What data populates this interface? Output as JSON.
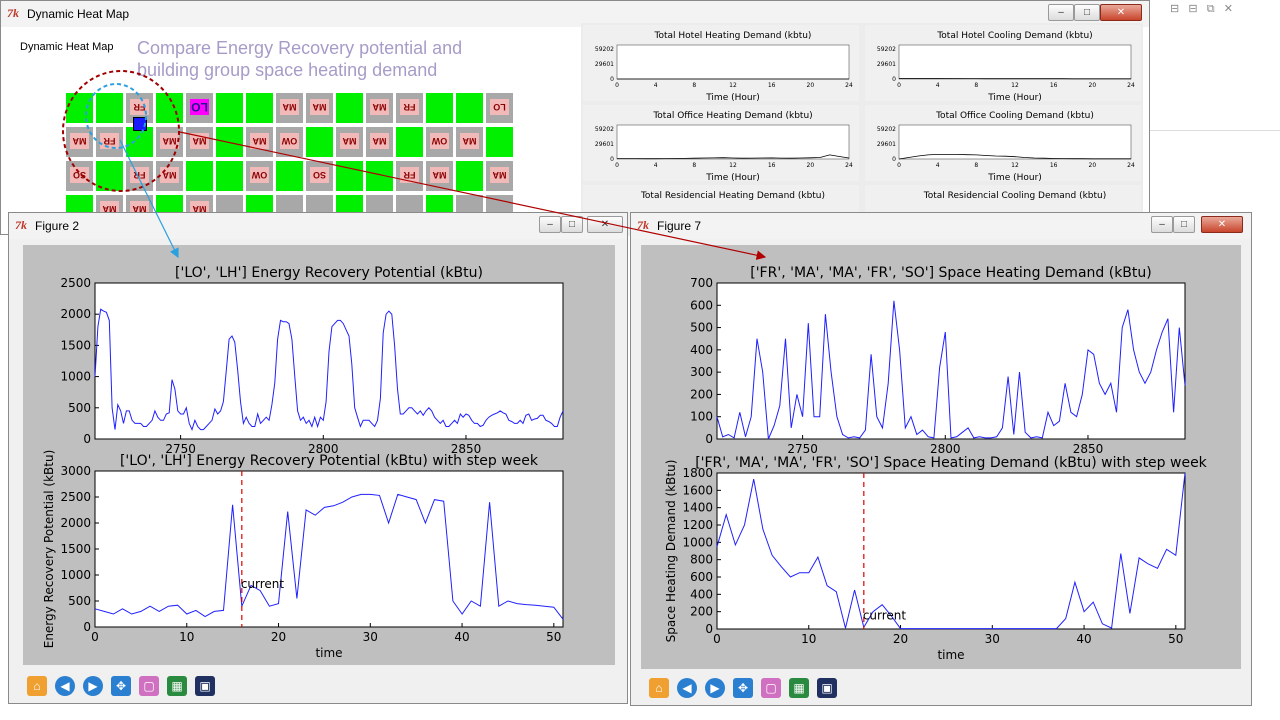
{
  "main_window": {
    "title": "Dynamic Heat Map",
    "panel_label": "Dynamic Heat Map"
  },
  "annotation": {
    "line1": "Compare Energy Recovery potential and",
    "line2": "building  group space heating demand",
    "color": "#a79cc8"
  },
  "map_labels": [
    "FR",
    "LO",
    "MA",
    "MA",
    "MA",
    "FR",
    "LO",
    "MA",
    "FR",
    "MA",
    "MA",
    "MA",
    "OW",
    "MA",
    "MA",
    "OW",
    "MA",
    "SO",
    "FR",
    "MA",
    "OW",
    "SO",
    "FR",
    "MA",
    "MA",
    "MA",
    "MA",
    "MA"
  ],
  "mini_charts": [
    {
      "title": "Total Hotel Heating Demand (kbtu)",
      "xlabel": "Time (Hour)",
      "yticks": [
        "59202",
        "29601",
        "0"
      ],
      "xticks": [
        "0",
        "4",
        "8",
        "12",
        "16",
        "20",
        "24"
      ],
      "values": [
        0,
        0,
        0,
        0,
        0,
        0,
        0,
        0,
        0,
        0,
        0,
        0,
        0,
        0,
        0,
        0,
        0,
        0,
        0,
        0,
        0,
        0,
        0,
        0,
        0
      ]
    },
    {
      "title": "Total Hotel Cooling Demand (kbtu)",
      "xlabel": "Time (Hour)",
      "yticks": [
        "59202",
        "29601",
        "0"
      ],
      "xticks": [
        "0",
        "4",
        "8",
        "12",
        "16",
        "20",
        "24"
      ],
      "values": [
        1200,
        1200,
        1200,
        1200,
        1100,
        1000,
        900,
        800,
        700,
        600,
        500,
        500,
        500,
        500,
        500,
        500,
        500,
        500,
        400,
        400,
        300,
        300,
        300,
        300,
        300
      ]
    },
    {
      "title": "Total Office Heating Demand (kbtu)",
      "xlabel": "Time (Hour)",
      "yticks": [
        "59202",
        "29601",
        "0"
      ],
      "xticks": [
        "0",
        "4",
        "8",
        "12",
        "16",
        "20",
        "24"
      ],
      "values": [
        800,
        800,
        700,
        500,
        500,
        700,
        900,
        1200,
        1500,
        2000,
        2200,
        2500,
        2000,
        1600,
        1800,
        2000,
        2200,
        1800,
        1600,
        2000,
        2300,
        3000,
        8000,
        5000,
        2000
      ]
    },
    {
      "title": "Total Office Cooling Demand (kbtu)",
      "xlabel": "Time (Hour)",
      "yticks": [
        "59202",
        "29601",
        "0"
      ],
      "xticks": [
        "0",
        "4",
        "8",
        "12",
        "16",
        "20",
        "24"
      ],
      "values": [
        0,
        3000,
        6000,
        8000,
        9000,
        9000,
        9000,
        8500,
        8000,
        7000,
        6000,
        5500,
        4500,
        3000,
        2000,
        1500,
        1000,
        800,
        600,
        500,
        400,
        300,
        300,
        300,
        300
      ]
    },
    {
      "title": "Total Residencial Heating Demand (kbtu)"
    },
    {
      "title": "Total Residencial Cooling Demand (kbtu)"
    }
  ],
  "figure2": {
    "title": "Figure 2",
    "chart_data": [
      {
        "type": "line",
        "title": "['LO', 'LH'] Energy Recovery Potential (kBtu)",
        "xlim": [
          2720,
          2884
        ],
        "ylim": [
          0,
          2500
        ],
        "xticks": [
          "2750",
          "2800",
          "2850"
        ],
        "yticks": [
          "0",
          "500",
          "1000",
          "1500",
          "2000",
          "2500"
        ],
        "color": "#2020ff",
        "x": [
          2720,
          2721,
          2722,
          2723,
          2724,
          2725,
          2726,
          2727,
          2728,
          2729,
          2730,
          2731,
          2732,
          2733,
          2734,
          2735,
          2736,
          2737,
          2738,
          2739,
          2740,
          2741,
          2742,
          2743,
          2744,
          2745,
          2746,
          2747,
          2748,
          2749,
          2750,
          2751,
          2752,
          2753,
          2754,
          2755,
          2756,
          2757,
          2758,
          2759,
          2760,
          2761,
          2762,
          2763,
          2764,
          2765,
          2766,
          2767,
          2768,
          2769,
          2770,
          2771,
          2772,
          2773,
          2774,
          2775,
          2776,
          2777,
          2778,
          2779,
          2780,
          2781,
          2782,
          2783,
          2784,
          2785,
          2786,
          2787,
          2788,
          2789,
          2790,
          2791,
          2792,
          2793,
          2794,
          2795,
          2796,
          2797,
          2798,
          2799,
          2800,
          2801,
          2802,
          2803,
          2804,
          2805,
          2806,
          2807,
          2808,
          2809,
          2810,
          2811,
          2812,
          2813,
          2814,
          2815,
          2816,
          2817,
          2818,
          2819,
          2820,
          2821,
          2822,
          2823,
          2824,
          2825,
          2826,
          2827,
          2828,
          2829,
          2830,
          2831,
          2832,
          2833,
          2834,
          2835,
          2836,
          2837,
          2838,
          2839,
          2840,
          2841,
          2842,
          2843,
          2844,
          2845,
          2846,
          2847,
          2848,
          2849,
          2850,
          2851,
          2852,
          2853,
          2854,
          2855,
          2856,
          2857,
          2858,
          2859,
          2860,
          2861,
          2862,
          2863,
          2864,
          2865,
          2866,
          2867,
          2868,
          2869,
          2870,
          2871,
          2872,
          2873,
          2874,
          2875,
          2876,
          2877,
          2878,
          2879,
          2880,
          2881,
          2882,
          2883,
          2884
        ],
        "y": [
          1000,
          1800,
          2080,
          2050,
          2030,
          1900,
          500,
          150,
          550,
          450,
          250,
          450,
          450,
          300,
          250,
          250,
          250,
          200,
          200,
          250,
          300,
          450,
          350,
          300,
          300,
          400,
          420,
          950,
          800,
          450,
          400,
          400,
          500,
          250,
          150,
          300,
          200,
          150,
          150,
          200,
          250,
          300,
          480,
          400,
          450,
          600,
          1100,
          1600,
          1650,
          1550,
          1100,
          600,
          250,
          350,
          250,
          200,
          200,
          400,
          250,
          300,
          350,
          300,
          550,
          900,
          1600,
          1900,
          1880,
          1880,
          1850,
          1600,
          1000,
          450,
          300,
          350,
          250,
          300,
          200,
          350,
          200,
          350,
          300,
          600,
          1400,
          1800,
          1850,
          1900,
          1900,
          1850,
          1750,
          1650,
          1200,
          500,
          350,
          200,
          300,
          300,
          300,
          250,
          200,
          300,
          650,
          1700,
          2000,
          2050,
          2000,
          1500,
          800,
          400,
          400,
          450,
          500,
          500,
          450,
          400,
          450,
          380,
          450,
          500,
          450,
          350,
          300,
          250,
          300,
          200,
          200,
          250,
          300,
          250,
          400,
          350,
          400,
          380,
          300,
          250,
          250,
          200,
          220,
          300,
          350,
          380,
          400,
          420,
          450,
          420,
          400,
          300,
          280,
          250,
          250,
          300,
          250,
          380,
          400,
          300,
          320,
          330,
          380,
          380,
          300,
          280,
          250,
          200,
          200,
          350,
          450,
          480,
          520,
          600,
          450
        ]
      },
      {
        "type": "line",
        "title": "['LO', 'LH'] Energy Recovery Potential (kBtu) with step week",
        "xlabel": "time",
        "ylabel": "Energy Recovery Potential (kBtu)",
        "xlim": [
          0,
          51
        ],
        "ylim": [
          0,
          3000
        ],
        "xticks": [
          "0",
          "10",
          "20",
          "30",
          "40",
          "50"
        ],
        "yticks": [
          "0",
          "500",
          "1000",
          "1500",
          "2000",
          "2500",
          "3000"
        ],
        "color": "#2020ff",
        "marker_x": 16,
        "marker_label": "current",
        "x": [
          0,
          1,
          2,
          3,
          4,
          5,
          6,
          7,
          8,
          9,
          10,
          11,
          12,
          13,
          14,
          15,
          16,
          17,
          18,
          19,
          20,
          21,
          22,
          23,
          24,
          25,
          26,
          27,
          28,
          29,
          30,
          31,
          32,
          33,
          34,
          35,
          36,
          37,
          38,
          39,
          40,
          41,
          42,
          43,
          44,
          45,
          46,
          47,
          48,
          49,
          50,
          51
        ],
        "y": [
          350,
          300,
          250,
          350,
          250,
          300,
          400,
          300,
          400,
          420,
          250,
          320,
          200,
          300,
          320,
          2350,
          400,
          800,
          700,
          400,
          450,
          2220,
          550,
          2250,
          2150,
          2300,
          2330,
          2400,
          2500,
          2550,
          2550,
          2530,
          2000,
          2550,
          2500,
          2450,
          2000,
          2450,
          2420,
          500,
          250,
          500,
          400,
          2400,
          400,
          500,
          450,
          430,
          420,
          400,
          380,
          150
        ]
      }
    ]
  },
  "figure7": {
    "title": "Figure 7",
    "chart_data": [
      {
        "type": "line",
        "title": "['FR', 'MA', 'MA', 'FR', 'SO'] Space Heating Demand (kBtu)",
        "xlim": [
          2720,
          2884
        ],
        "ylim": [
          0,
          700
        ],
        "xticks": [
          "2750",
          "2800",
          "2850"
        ],
        "yticks": [
          "0",
          "100",
          "200",
          "300",
          "400",
          "500",
          "600",
          "700"
        ],
        "color": "#2020ff",
        "x": [
          2720,
          2722,
          2724,
          2726,
          2728,
          2730,
          2732,
          2734,
          2736,
          2738,
          2740,
          2742,
          2744,
          2746,
          2748,
          2750,
          2752,
          2754,
          2756,
          2758,
          2760,
          2762,
          2764,
          2766,
          2768,
          2770,
          2772,
          2774,
          2776,
          2778,
          2780,
          2782,
          2784,
          2786,
          2788,
          2790,
          2792,
          2794,
          2796,
          2798,
          2800,
          2802,
          2804,
          2806,
          2808,
          2810,
          2812,
          2814,
          2816,
          2818,
          2820,
          2822,
          2824,
          2826,
          2828,
          2830,
          2832,
          2834,
          2836,
          2838,
          2840,
          2842,
          2844,
          2846,
          2848,
          2850,
          2852,
          2854,
          2856,
          2858,
          2860,
          2862,
          2864,
          2866,
          2868,
          2870,
          2872,
          2874,
          2876,
          2878,
          2880,
          2882,
          2884
        ],
        "y": [
          100,
          10,
          20,
          5,
          120,
          10,
          100,
          450,
          300,
          0,
          60,
          150,
          450,
          50,
          200,
          100,
          520,
          100,
          100,
          560,
          300,
          100,
          20,
          5,
          10,
          5,
          40,
          380,
          100,
          50,
          250,
          620,
          400,
          50,
          100,
          20,
          40,
          10,
          5,
          320,
          480,
          5,
          10,
          30,
          50,
          5,
          10,
          5,
          5,
          10,
          50,
          280,
          20,
          300,
          30,
          5,
          10,
          5,
          120,
          60,
          80,
          250,
          120,
          100,
          200,
          400,
          380,
          250,
          200,
          250,
          120,
          500,
          580,
          400,
          300,
          250,
          300,
          400,
          480,
          540,
          120,
          500,
          240
        ]
      },
      {
        "type": "line",
        "title": "['FR', 'MA', 'MA', 'FR', 'SO'] Space Heating Demand (kBtu) with step week",
        "xlabel": "time",
        "ylabel": "Space Heating Demand (kBtu)",
        "xlim": [
          0,
          51
        ],
        "ylim": [
          0,
          1800
        ],
        "xticks": [
          "0",
          "10",
          "20",
          "30",
          "40",
          "50"
        ],
        "yticks": [
          "0",
          "200",
          "400",
          "600",
          "800",
          "1000",
          "1200",
          "1400",
          "1600",
          "1800"
        ],
        "color": "#2020ff",
        "marker_x": 16,
        "marker_label": "current",
        "x": [
          0,
          1,
          2,
          3,
          4,
          5,
          6,
          7,
          8,
          9,
          10,
          11,
          12,
          13,
          14,
          15,
          16,
          17,
          18,
          19,
          20,
          21,
          22,
          23,
          24,
          25,
          26,
          27,
          28,
          29,
          30,
          31,
          32,
          33,
          34,
          35,
          36,
          37,
          38,
          39,
          40,
          41,
          42,
          43,
          44,
          45,
          46,
          47,
          48,
          49,
          50,
          51
        ],
        "y": [
          950,
          1320,
          970,
          1200,
          1730,
          1150,
          850,
          720,
          600,
          650,
          650,
          830,
          500,
          430,
          10,
          450,
          20,
          200,
          280,
          150,
          5,
          5,
          5,
          5,
          5,
          5,
          5,
          5,
          5,
          5,
          5,
          5,
          5,
          5,
          5,
          5,
          5,
          5,
          120,
          540,
          200,
          310,
          60,
          10,
          870,
          180,
          820,
          750,
          700,
          920,
          850,
          1800
        ]
      }
    ]
  }
}
